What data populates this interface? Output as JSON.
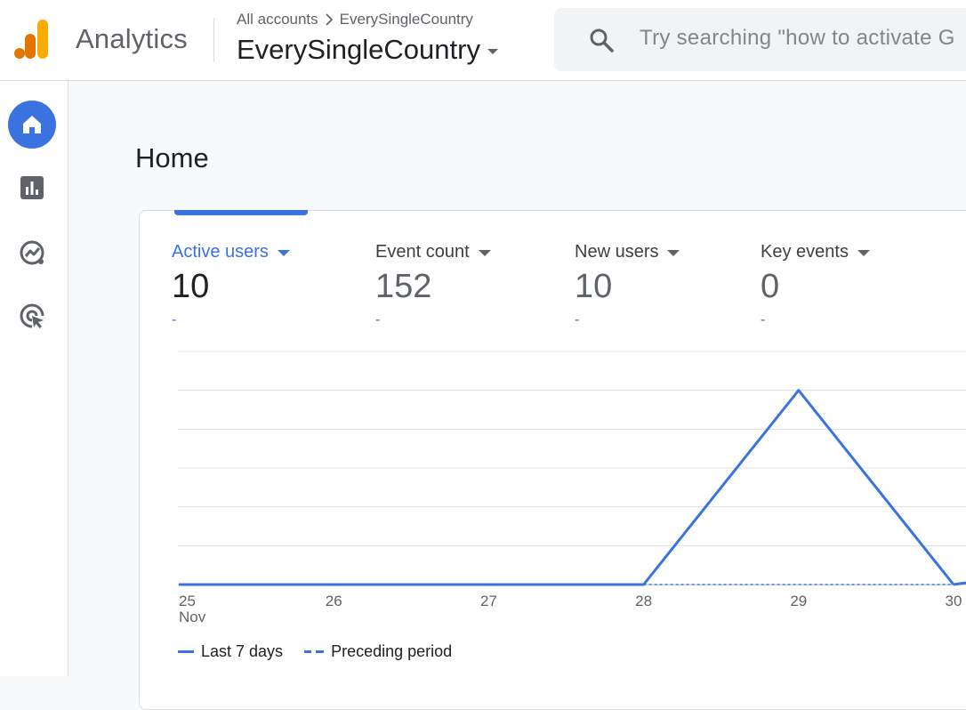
{
  "header": {
    "app_name": "Analytics",
    "breadcrumb": {
      "root": "All accounts",
      "current": "EverySingleCountry"
    },
    "property_name": "EverySingleCountry",
    "search_placeholder": "Try searching \"how to activate G"
  },
  "nav": {
    "items": [
      {
        "name": "home",
        "icon": "home-icon",
        "active": true
      },
      {
        "name": "reports",
        "icon": "bar-chart-icon",
        "active": false
      },
      {
        "name": "explore",
        "icon": "explore-icon",
        "active": false
      },
      {
        "name": "advertising",
        "icon": "target-cursor-icon",
        "active": false
      }
    ]
  },
  "page": {
    "title": "Home"
  },
  "metrics": [
    {
      "label": "Active users",
      "value": "10",
      "delta": "-",
      "active": true
    },
    {
      "label": "Event count",
      "value": "152",
      "delta": "-",
      "active": false
    },
    {
      "label": "New users",
      "value": "10",
      "delta": "-",
      "active": false
    },
    {
      "label": "Key events",
      "value": "0",
      "delta": "-",
      "active": false
    }
  ],
  "legend": {
    "current": "Last 7 days",
    "previous": "Preceding period"
  },
  "colors": {
    "accent": "#3a73e0",
    "grid": "#e0e0e0",
    "text": "#202124",
    "muted": "#5f6368"
  },
  "chart_data": {
    "type": "line",
    "x": [
      "25",
      "26",
      "27",
      "28",
      "29",
      "30"
    ],
    "x_sublabels": [
      "Nov",
      "",
      "",
      "",
      "",
      ""
    ],
    "series": [
      {
        "name": "Last 7 days",
        "style": "solid",
        "values": [
          0,
          0,
          0,
          0,
          5,
          0
        ]
      },
      {
        "name": "Preceding period",
        "style": "dashed",
        "values": [
          null,
          null,
          null,
          0,
          0,
          0
        ]
      }
    ],
    "ylim": [
      0,
      6
    ],
    "grid": true
  }
}
